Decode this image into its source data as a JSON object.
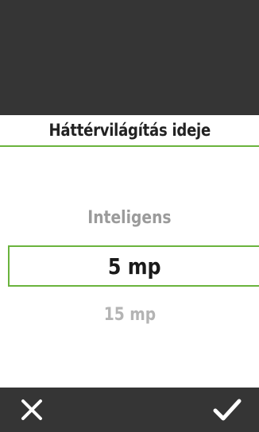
{
  "screen": {
    "title": "Háttérvilágítás ideje"
  },
  "picker": {
    "options": [
      "Inteligens",
      "5 mp",
      "15 mp"
    ],
    "selected_index": 1
  },
  "footer": {
    "cancel_icon": "close-icon",
    "confirm_icon": "checkmark-icon"
  },
  "colors": {
    "accent": "#6ab33d",
    "bar_background": "#353535",
    "text_dark": "#222222",
    "text_dim": "#9b9b9b"
  }
}
